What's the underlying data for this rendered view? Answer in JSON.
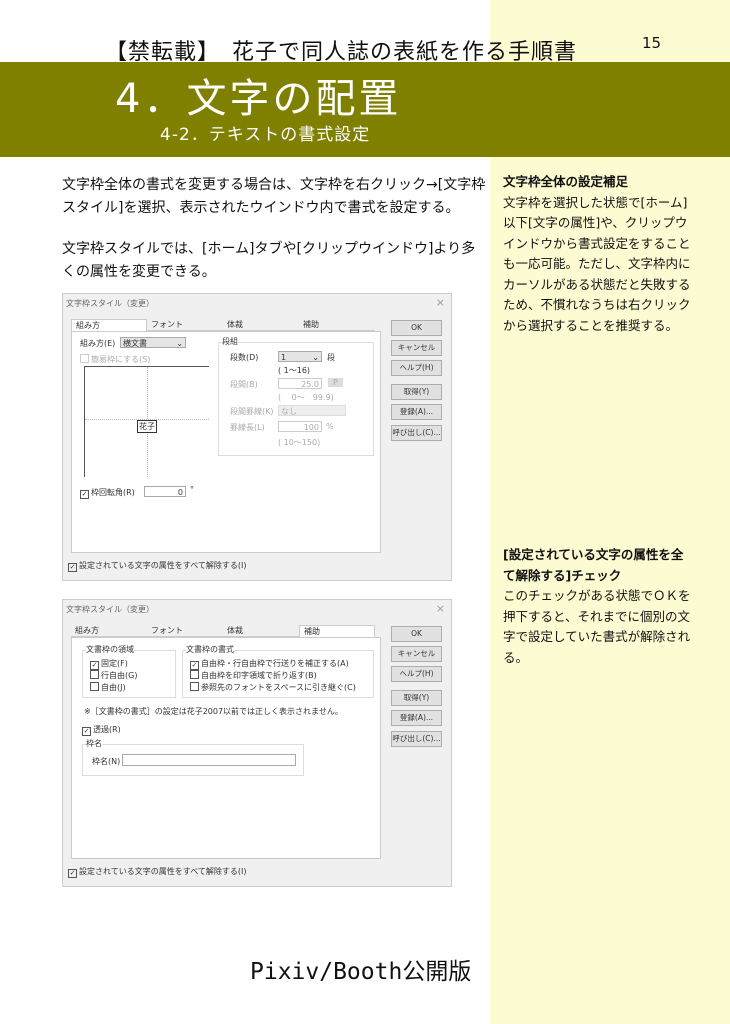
{
  "header": {
    "title": "【禁転載】　花子で同人誌の表紙を作る手順書",
    "page": "15"
  },
  "chapter": {
    "title": "4．文字の配置",
    "subtitle": "4-2．テキストの書式設定"
  },
  "body": [
    "文字枠全体の書式を変更する場合は、文字枠を右クリック→[文字枠スタイル]を選択、表示されたウインドウ内で書式を設定する。",
    "文字枠スタイルでは、[ホーム]タブや[クリップウインドウ]より多くの属性を変更できる。"
  ],
  "notes": [
    {
      "title": "文字枠全体の設定補足",
      "text": "文字枠を選択した状態で[ホーム]以下[文字の属性]や、クリップウインドウから書式設定をすることも一応可能。ただし、文字枠内にカーソルがある状態だと失敗するため、不慣れなうちは右クリックから選択することを推奨する。"
    },
    {
      "title": "[設定されている文字の属性を全て解除する]チェック",
      "text": "このチェックがある状態でＯＫを押下すると、それまでに個別の文字で設定していた書式が解除される。"
    }
  ],
  "dialog": {
    "title": "文字枠スタイル（変更）",
    "close": "×",
    "tabs": [
      "組み方",
      "フォント",
      "体裁",
      "補助"
    ],
    "buttons": [
      "OK",
      "キャンセル",
      "ヘルプ(H)",
      "取得(Y)",
      "登録(A)...",
      "呼び出し(C)..."
    ],
    "clear_all": "設定されている文字の属性をすべて解除する(I)"
  },
  "layout_tab": {
    "kumikata_label": "組み方(E)",
    "kumikata_value": "横文書",
    "simple": "簡易枠にする(S)",
    "preview_text": "花子",
    "columns_group": "段組",
    "dansu_label": "段数(D)",
    "dansu_value": "1",
    "dan": "段",
    "dansu_range": "( 1～16)",
    "dankan_label": "段間(B)",
    "dankan_value": "25.0",
    "p": "P",
    "dankan_range": "(　 0～　99.9)",
    "keisen_label": "段間罫線(K)",
    "keisen_value": "なし",
    "keisenlen_label": "罫線長(L)",
    "keisenlen_value": "100",
    "pct": "%",
    "keisenlen_range": "( 10～150)",
    "rotate_label": "枠回転角(R)",
    "rotate_value": "0",
    "deg": "°"
  },
  "assist_tab": {
    "area_group": "文書枠の領域",
    "area_opts": [
      "固定(F)",
      "行自由(G)",
      "自由(J)"
    ],
    "format_group": "文書枠の書式",
    "format_opts": [
      "自由枠・行自由枠で行送りを補正する(A)",
      "自由枠を印字領域で折り返す(B)",
      "参照先のフォントをスペースに引き継ぐ(C)"
    ],
    "note": "※［文書枠の書式］の設定は花子2007以前では正しく表示されません。",
    "transparent": "透過(R)",
    "name_group": "枠名",
    "name_label": "枠名(N)",
    "name_value": ""
  },
  "footer": "Pixiv/Booth公開版",
  "colors": {
    "band": "#7f7f00",
    "sidebar": "#fdfbd2"
  }
}
